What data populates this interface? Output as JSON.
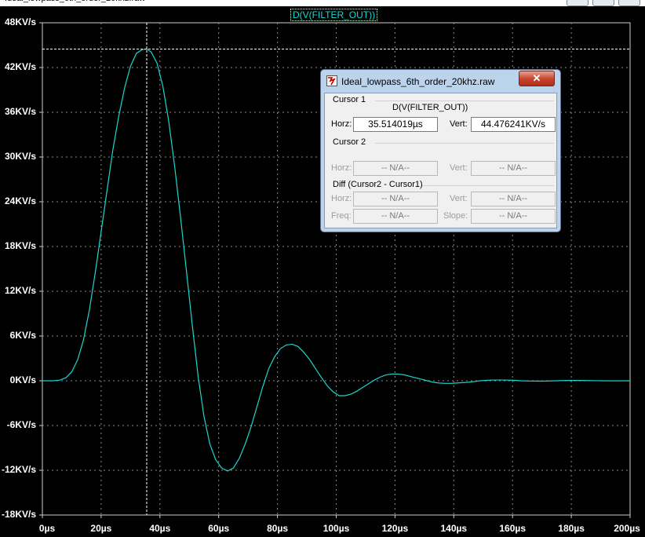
{
  "window": {
    "title": "Ideal_lowpass_6th_order_20khz.raw"
  },
  "plot": {
    "trace_label": "D(V(FILTER_OUT))",
    "colors": {
      "background": "#000000",
      "trace": "#19d7d0",
      "grid": "#8a8a8a",
      "cursor": "#ffffff",
      "axis_text": "#ffffff"
    }
  },
  "chart_data": {
    "type": "line",
    "title": "D(V(FILTER_OUT))",
    "xlabel": "",
    "ylabel": "",
    "xlim": [
      0,
      200
    ],
    "ylim": [
      -18,
      48
    ],
    "x_unit": "µs",
    "y_unit": "KV/s",
    "grid": true,
    "x_ticks": [
      "0µs",
      "20µs",
      "40µs",
      "60µs",
      "80µs",
      "100µs",
      "120µs",
      "140µs",
      "160µs",
      "180µs",
      "200µs"
    ],
    "y_ticks": [
      "48KV/s",
      "42KV/s",
      "36KV/s",
      "30KV/s",
      "24KV/s",
      "18KV/s",
      "12KV/s",
      "6KV/s",
      "0KV/s",
      "-6KV/s",
      "-12KV/s",
      "-18KV/s"
    ],
    "series": [
      {
        "name": "D(V(FILTER_OUT))",
        "x": [
          0,
          4,
          6,
          8,
          10,
          12,
          14,
          16,
          18,
          20,
          22,
          24,
          26,
          28,
          30,
          32,
          34,
          35.5,
          37,
          39,
          41,
          43,
          45,
          47,
          49,
          51,
          53,
          55,
          57,
          59,
          61,
          63,
          65,
          67,
          69,
          71,
          73,
          75,
          77,
          79,
          81,
          83,
          85,
          87,
          89,
          91,
          93,
          95,
          97,
          99,
          101,
          103,
          105,
          107,
          109,
          111,
          113,
          115,
          117,
          119,
          121,
          123,
          125,
          127,
          129,
          131,
          133,
          135,
          137,
          139,
          141,
          143,
          145,
          147,
          149,
          151,
          153,
          155,
          157,
          159,
          161,
          163,
          165,
          170,
          175,
          180,
          185,
          190,
          195,
          200
        ],
        "y": [
          0,
          0,
          0.1,
          0.4,
          1.2,
          2.8,
          5.5,
          9.5,
          14.5,
          20,
          25.5,
          31,
          35.5,
          39.3,
          42.2,
          43.9,
          44.4,
          44.48,
          44.1,
          42.6,
          39.5,
          34.8,
          28.8,
          22,
          14.8,
          7.5,
          0.6,
          -4.8,
          -8.5,
          -10.6,
          -11.7,
          -12.1,
          -11.7,
          -10.4,
          -8.5,
          -6.2,
          -3.5,
          -0.8,
          1.6,
          3.2,
          4.3,
          4.8,
          4.9,
          4.6,
          3.8,
          2.8,
          1.6,
          0.4,
          -0.7,
          -1.5,
          -2,
          -2,
          -1.8,
          -1.4,
          -0.9,
          -0.4,
          0.1,
          0.5,
          0.8,
          0.9,
          0.9,
          0.8,
          0.6,
          0.4,
          0.2,
          0,
          -0.2,
          -0.3,
          -0.35,
          -0.35,
          -0.3,
          -0.25,
          -0.2,
          -0.1,
          0,
          0.05,
          0.1,
          0.1,
          0.1,
          0.08,
          0.05,
          0,
          -0.03,
          -0.05,
          0,
          0.05,
          0.03,
          0,
          -0.01,
          0
        ]
      }
    ]
  },
  "cursor1": {
    "x": 35.514019,
    "y": 44.476241
  },
  "cursor_dialog": {
    "cursor1_title": "Cursor 1",
    "trace_name": "D(V(FILTER_OUT))",
    "horz_label": "Horz:",
    "horz_value": "35.514019µs",
    "vert_label": "Vert:",
    "vert_value": "44.476241KV/s",
    "cursor2_title": "Cursor 2",
    "cursor2_horz_label": "Horz:",
    "cursor2_horz_value": "-- N/A--",
    "cursor2_vert_label": "Vert:",
    "cursor2_vert_value": "-- N/A--",
    "diff_title": "Diff (Cursor2 - Cursor1)",
    "diff_vert_label": "Vert:",
    "diff_vert_value": "-- N/A--",
    "diff_freq_label": "Freq:",
    "diff_freq_value": "-- N/A--",
    "diff_slope_label": "Slope:",
    "diff_slope_value": "-- N/A--",
    "diff_horz_label": "Horz:",
    "diff_horz_value": "-- N/A--",
    "close_symbol": "✕"
  }
}
